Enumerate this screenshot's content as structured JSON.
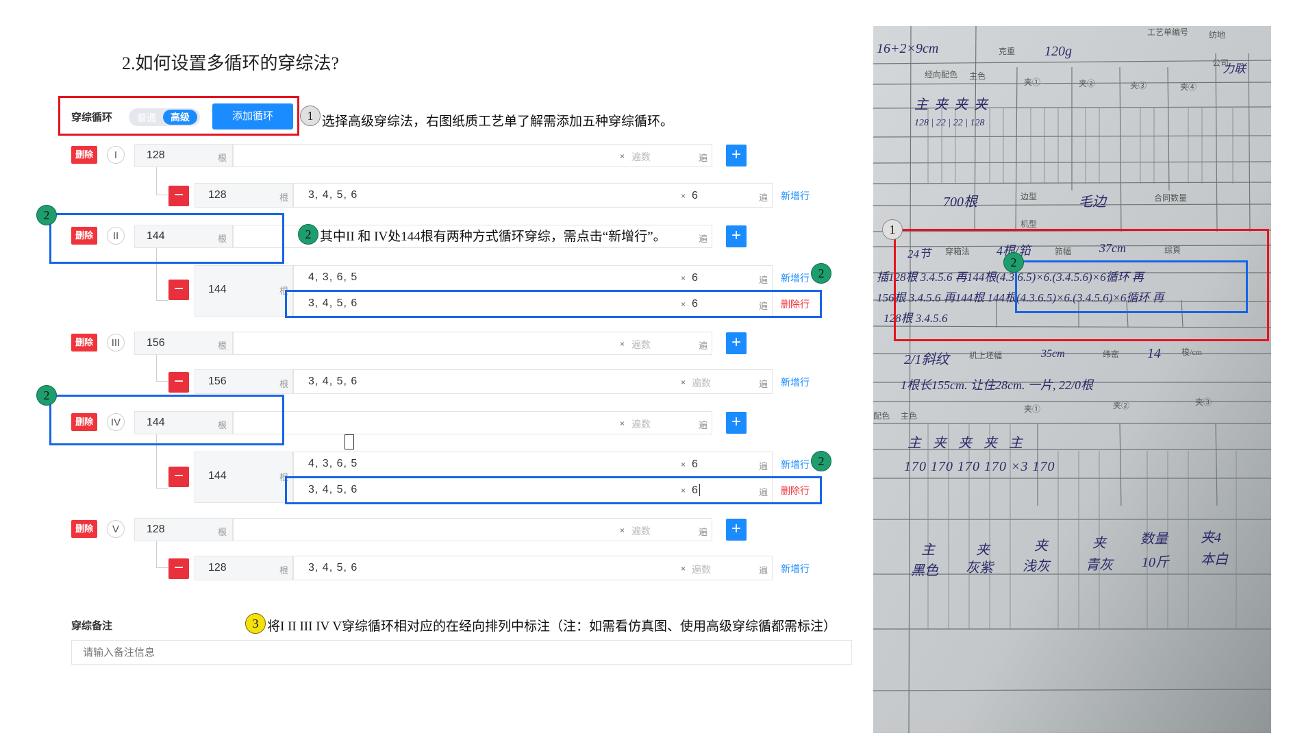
{
  "heading": "2.如何设置多循环的穿综法?",
  "toolbar": {
    "label": "穿综循环",
    "toggle_off": "普通",
    "toggle_on": "高级",
    "add_button": "添加循环"
  },
  "labels": {
    "delete": "删除",
    "unit_gen": "根",
    "unit_bian": "遍",
    "times": "×",
    "times_placeholder": "遍数",
    "add_row": "新增行",
    "remove_row": "删除行",
    "plus": "+",
    "minus": "−"
  },
  "cycles": [
    {
      "roman": "I",
      "count": "128",
      "rows": [
        {
          "count": "128",
          "seq": "3, 4, 5, 6",
          "times": "6"
        }
      ]
    },
    {
      "roman": "II",
      "count": "144",
      "rows": [
        {
          "count": "144",
          "seq": "4, 3, 6, 5",
          "times": "6"
        },
        {
          "seq": "3, 4, 5, 6",
          "times": "6"
        }
      ]
    },
    {
      "roman": "III",
      "count": "156",
      "rows": [
        {
          "count": "156",
          "seq": "3, 4, 5, 6",
          "times": ""
        }
      ]
    },
    {
      "roman": "IV",
      "count": "144",
      "rows": [
        {
          "count": "144",
          "seq": "4, 3, 6, 5",
          "times": "6"
        },
        {
          "seq": "3, 4, 5, 6",
          "times": "6"
        }
      ]
    },
    {
      "roman": "V",
      "count": "128",
      "rows": [
        {
          "count": "128",
          "seq": "3, 4, 5, 6",
          "times": ""
        }
      ]
    }
  ],
  "remark": {
    "label": "穿综备注",
    "placeholder": "请输入备注信息"
  },
  "annotations": {
    "step1_num": "1",
    "step1": "选择高级穿综法，右图纸质工艺单了解需添加五种穿综循环。",
    "step2_num": "2",
    "step2": "其中II 和 IV处144根有两种方式循环穿综，需点击“新增行”。",
    "step3_num": "3",
    "step3": "将I II III IV V穿综循环相对应的在经向排列中标注（注：如需看仿真图、使用高级穿综循都需标注）"
  },
  "photo": {
    "printed": [
      "克重",
      "经向配色",
      "主色",
      "夹①",
      "夹②",
      "夹③",
      "夹④",
      "公司",
      "穿箱法",
      "筘幅",
      "综頁",
      "边型",
      "机型",
      "合同数量",
      "机上坯幅",
      "纬密",
      "梭/cm",
      "配色",
      "主色",
      "夹①",
      "夹②",
      "夹③",
      "工艺单编号",
      "纺地"
    ],
    "handwritten": [
      "16+2×9cm",
      "120g",
      "力联",
      "主 夹 夹 夹",
      "128 | 22 | 22 | 128",
      "700根",
      "毛边",
      "24节",
      "4根/筘",
      "37cm",
      "插128根 3.4.5.6 再144根(4.3.6.5)×6.(3.4.5.6)×6循环 再",
      "156根 3.4.5.6 再144根 144根(4.3.6.5)×6.(3.4.5.6)×6循环 再",
      "128根 3.4.5.6",
      "2/1斜纹",
      "35cm",
      "14",
      "1根长155cm. 让住28cm. 一片, 22/0根",
      "主 夹 夹 夹 主",
      "170 170 170 170 ×3 170",
      "主",
      "夹",
      "夹",
      "夹",
      "数量",
      "夹4",
      "黑色",
      "灰紫",
      "浅灰",
      "青灰",
      "10斤",
      "本白"
    ]
  },
  "colors": {
    "primary": "#1a8cff",
    "danger": "#f0343c",
    "annot_red": "#e5141f",
    "annot_blue": "#1565e8",
    "annot_green": "#1e9e6e",
    "annot_yellow": "#f4e10c"
  }
}
